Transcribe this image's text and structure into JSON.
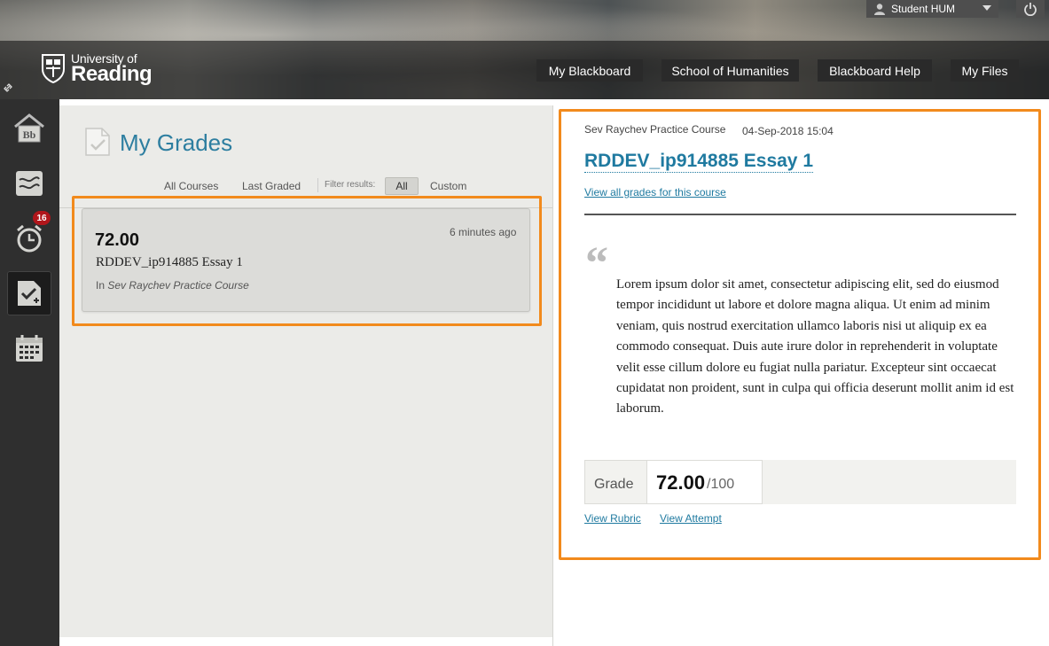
{
  "header": {
    "logo_line1": "University of",
    "logo_line2": "Reading",
    "user_name": "Student HUM",
    "nav": [
      "My Blackboard",
      "School of Humanities",
      "Blackboard Help",
      "My Files"
    ]
  },
  "rail": {
    "alerts_count": "16"
  },
  "grades": {
    "title": "My Grades",
    "filters": {
      "all_courses": "All Courses",
      "last_graded": "Last Graded",
      "filter_label": "Filter results:",
      "all": "All",
      "custom": "Custom"
    },
    "items": [
      {
        "score": "72.00",
        "time": "6 minutes ago",
        "name": "RDDEV_ip914885 Essay 1",
        "in_label": "In",
        "course": "Sev Raychev Practice Course"
      }
    ]
  },
  "detail": {
    "course": "Sev Raychev Practice Course",
    "date": "04-Sep-2018 15:04",
    "title": "RDDEV_ip914885 Essay 1",
    "view_all": "View all grades for this course",
    "quote_mark": "“",
    "feedback": "Lorem ipsum dolor sit amet, consectetur adipiscing elit, sed do eiusmod tempor incididunt ut labore et dolore magna aliqua. Ut enim ad minim veniam, quis nostrud exercitation ullamco laboris nisi ut aliquip ex ea commodo consequat. Duis aute irure dolor in reprehenderit in voluptate velit esse cillum dolore eu fugiat nulla pariatur. Excepteur sint occaecat cupidatat non proident, sunt in culpa qui officia deserunt mollit anim id est laborum.",
    "grade_label": "Grade",
    "grade_value": "72.00",
    "grade_out_of": "/100",
    "view_rubric": "View Rubric",
    "view_attempt": "View Attempt"
  },
  "colors": {
    "accent": "#2d7ea0",
    "highlight": "#f28a1c",
    "badge": "#b0161b"
  }
}
